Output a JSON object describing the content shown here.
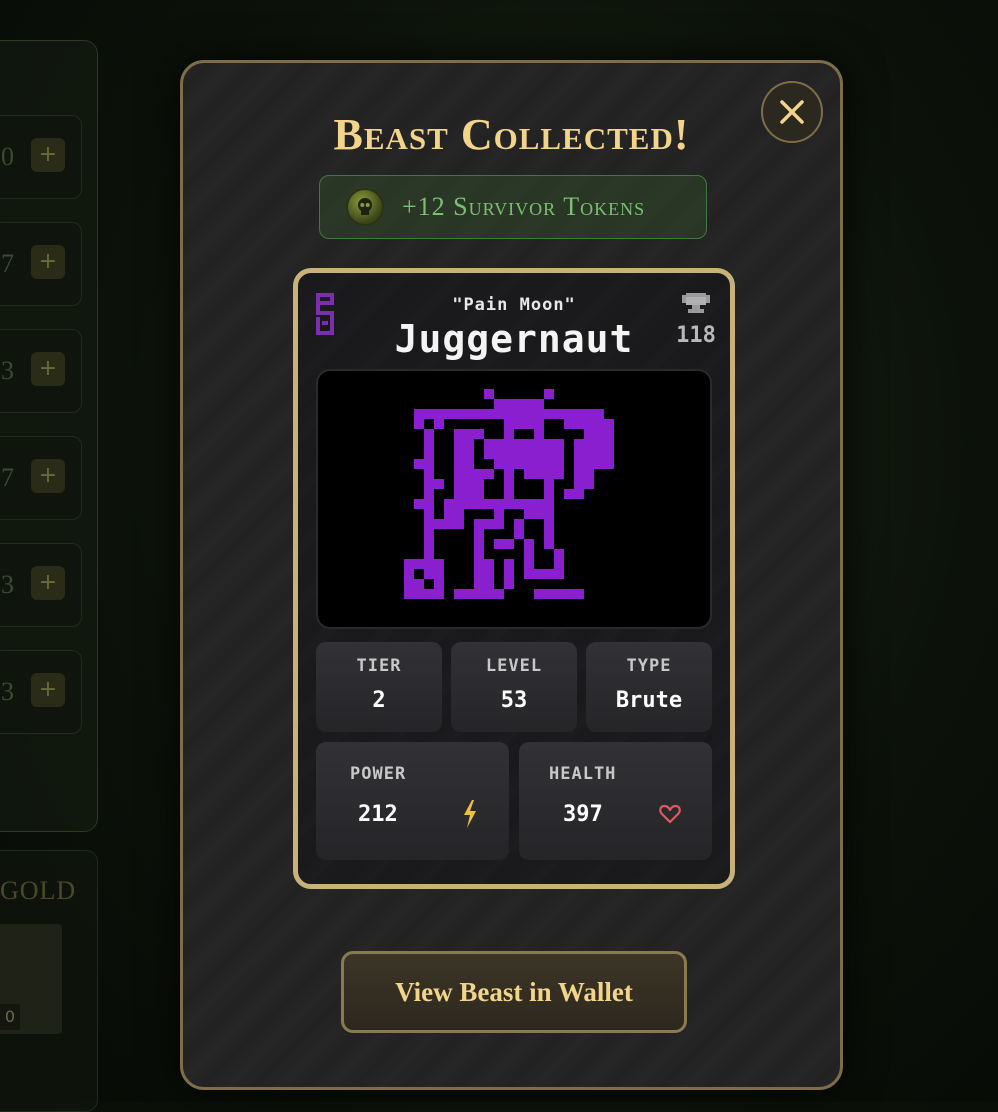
{
  "background": {
    "row_values": [
      "0",
      "7",
      "3",
      "7",
      "3",
      "3"
    ],
    "plus_label": "+",
    "gold_label": "GOLD",
    "item_count": "0"
  },
  "modal": {
    "title": "Beast Collected!",
    "tokens_reward": "+12 Survivor Tokens",
    "wallet_button": "View Beast in Wallet"
  },
  "beast": {
    "prefix": "\"Pain Moon\"",
    "name": "Juggernaut",
    "rank": "118",
    "image_color": "#8a1fd0",
    "stats": {
      "tier_label": "TIER",
      "tier": "2",
      "level_label": "LEVEL",
      "level": "53",
      "type_label": "TYPE",
      "type": "Brute",
      "power_label": "POWER",
      "power": "212",
      "health_label": "HEALTH",
      "health": "397"
    }
  },
  "colors": {
    "gold": "#f2d48a",
    "token_green": "#7bc070",
    "beast_purple": "#8a1fd0",
    "power_yellow": "#f2c038",
    "health_red": "#e05a5a"
  }
}
